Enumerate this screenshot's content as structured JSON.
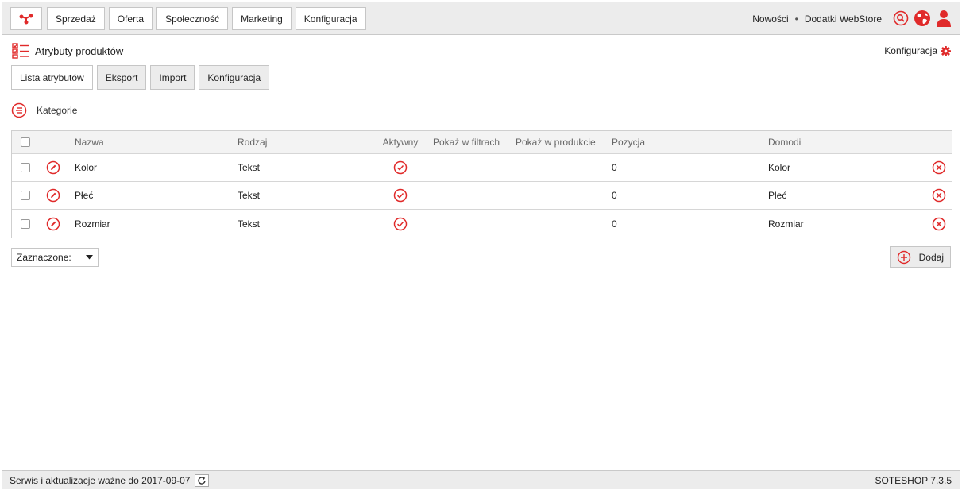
{
  "nav": {
    "items": [
      "Sprzedaż",
      "Oferta",
      "Społeczność",
      "Marketing",
      "Konfiguracja"
    ],
    "links": {
      "news": "Nowości",
      "separator": "•",
      "addons": "Dodatki WebStore"
    }
  },
  "page": {
    "title": "Atrybuty produktów",
    "config_label": "Konfiguracja",
    "tabs": [
      "Lista atrybutów",
      "Eksport",
      "Import",
      "Konfiguracja"
    ],
    "categories_label": "Kategorie"
  },
  "table": {
    "headers": {
      "name": "Nazwa",
      "type": "Rodzaj",
      "active": "Aktywny",
      "show_filters": "Pokaż w filtrach",
      "show_product": "Pokaż w produkcie",
      "position": "Pozycja",
      "domodi": "Domodi"
    },
    "rows": [
      {
        "name": "Kolor",
        "type": "Tekst",
        "active": true,
        "show_filters": "",
        "show_product": "",
        "position": "0",
        "domodi": "Kolor"
      },
      {
        "name": "Płeć",
        "type": "Tekst",
        "active": true,
        "show_filters": "",
        "show_product": "",
        "position": "0",
        "domodi": "Płeć"
      },
      {
        "name": "Rozmiar",
        "type": "Tekst",
        "active": true,
        "show_filters": "",
        "show_product": "",
        "position": "0",
        "domodi": "Rozmiar"
      }
    ]
  },
  "actions": {
    "selected_label": "Zaznaczone:",
    "add_label": "Dodaj"
  },
  "footer": {
    "service_text": "Serwis i aktualizacje ważne do 2017-09-07",
    "version": "SOTESHOP 7.3.5"
  },
  "colors": {
    "accent": "#e02a2a",
    "bar_bg": "#ececec",
    "border": "#c6c6c6"
  },
  "icons": {
    "logo": "share-nodes-icon",
    "search": "search-icon",
    "globe": "globe-icon",
    "user": "user-icon",
    "settings": "gear-icon",
    "attributes": "checklist-icon",
    "category": "list-circle-icon",
    "edit": "pencil-circle-icon",
    "active": "check-circle-icon",
    "delete": "x-circle-icon",
    "add": "plus-circle-icon",
    "dropdown": "caret-down-icon",
    "refresh": "refresh-icon"
  }
}
